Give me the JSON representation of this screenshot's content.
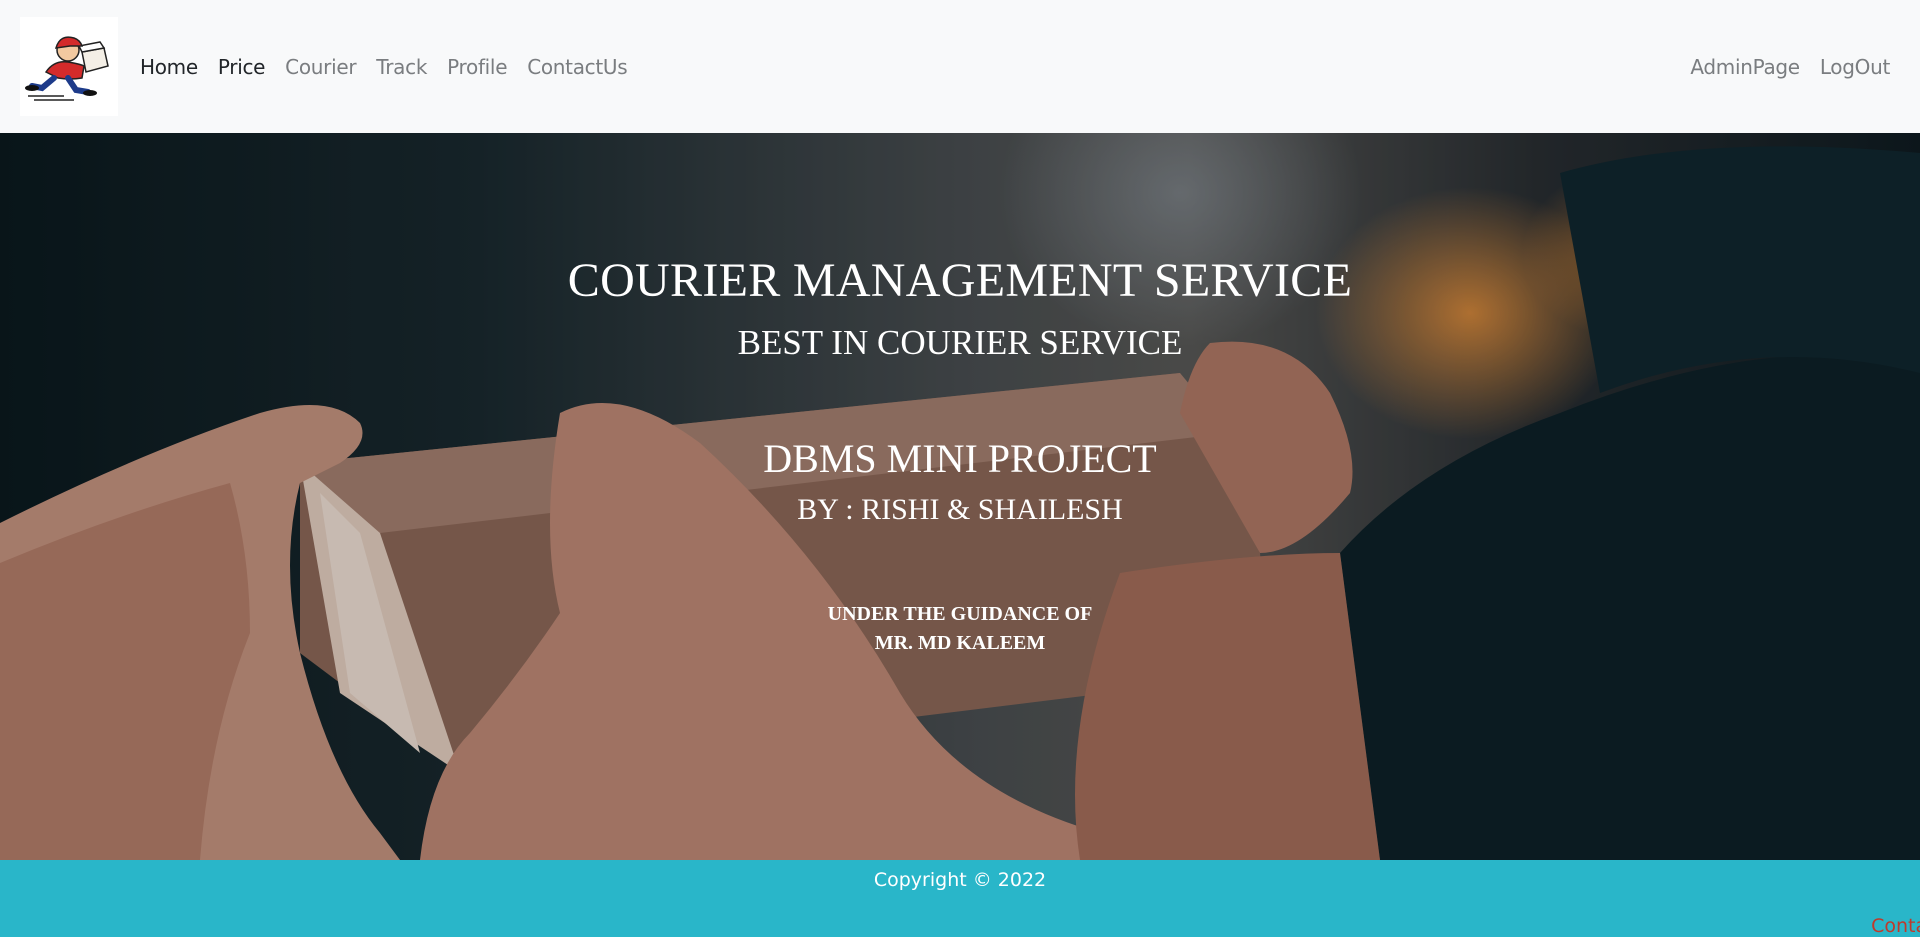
{
  "navbar": {
    "logo_icon": "courier-delivery-man-logo",
    "left_links": [
      {
        "label": "Home",
        "active": true
      },
      {
        "label": "Price",
        "active": true
      },
      {
        "label": "Courier",
        "active": false
      },
      {
        "label": "Track",
        "active": false
      },
      {
        "label": "Profile",
        "active": false
      },
      {
        "label": "ContactUs",
        "active": false
      }
    ],
    "right_links": [
      {
        "label": "AdminPage"
      },
      {
        "label": "LogOut"
      }
    ]
  },
  "hero": {
    "title": "COURIER MANAGEMENT SERVICE",
    "subtitle": "BEST IN COURIER SERVICE",
    "project": "DBMS MINI PROJECT",
    "authors": "BY : RISHI & SHAILESH",
    "guidance_line1": "UNDER THE GUIDANCE OF",
    "guidance_line2": "MR. MD KALEEM"
  },
  "footer": {
    "copyright": "Copyright © 2022",
    "link": "ContactUs"
  },
  "colors": {
    "navbar_bg": "#f8f9fa",
    "footer_bg": "#29b6c9",
    "footer_link": "#c0392b",
    "nav_active": "#212529",
    "nav_inactive": "#7a7d80"
  }
}
